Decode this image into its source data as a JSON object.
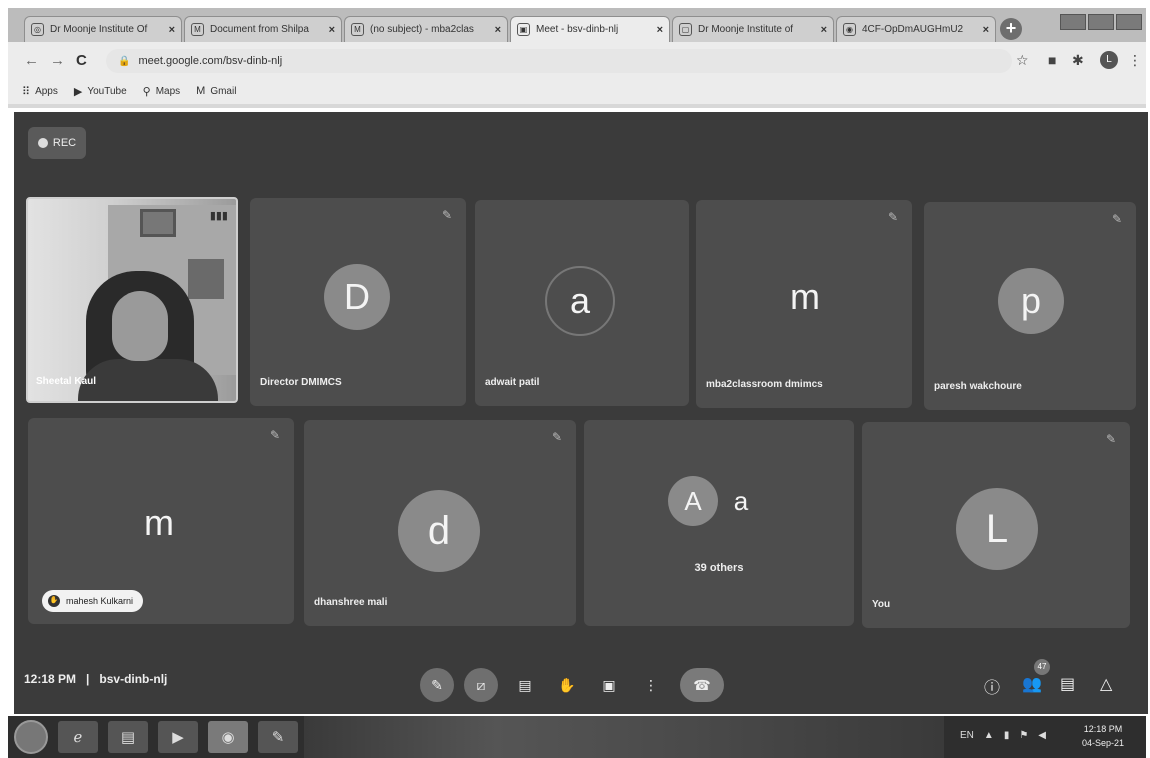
{
  "browser": {
    "tabs": [
      {
        "title": "Dr Moonje Institute Of",
        "icon": "globe-icon",
        "active": false
      },
      {
        "title": "Document from Shilpa",
        "icon": "gmail-icon",
        "active": false
      },
      {
        "title": "(no subject) - mba2clas",
        "icon": "gmail-icon",
        "active": false
      },
      {
        "title": "Meet - bsv-dinb-nlj",
        "icon": "meet-icon",
        "active": true
      },
      {
        "title": "Dr Moonje Institute of",
        "icon": "page-icon",
        "active": false
      },
      {
        "title": "4CF-OpDmAUGHmU2",
        "icon": "chrome-icon",
        "active": false
      }
    ],
    "url": "meet.google.com/bsv-dinb-nlj",
    "bookmarks": [
      {
        "label": "Apps",
        "icon": "apps-grid-icon"
      },
      {
        "label": "YouTube",
        "icon": "youtube-icon"
      },
      {
        "label": "Maps",
        "icon": "maps-pin-icon"
      },
      {
        "label": "Gmail",
        "icon": "gmail-icon"
      }
    ],
    "profile_initial": "L"
  },
  "meet": {
    "rec_label": "REC",
    "camera_tile": {
      "name": "Sheetal Kaul"
    },
    "tiles": [
      {
        "initial": "D",
        "name": "Director DMIMCS"
      },
      {
        "initial": "a",
        "name": "adwait patil"
      },
      {
        "initial": "m",
        "name": "mba2classroom dmimcs"
      },
      {
        "initial": "p",
        "name": "paresh wakchoure"
      },
      {
        "initial": "m",
        "name": "mahesh Kulkarni"
      },
      {
        "initial": "d",
        "name": "dhanshree mali"
      },
      {
        "initial": "L",
        "name": "You"
      }
    ],
    "others": {
      "initial_a": "A",
      "initial_b": "a",
      "label": "39 others"
    },
    "bottom": {
      "time": "12:18 PM",
      "separator": "|",
      "meeting_code": "bsv-dinb-nlj",
      "participant_count": "47"
    }
  },
  "taskbar": {
    "language": "EN",
    "time": "12:18 PM",
    "date": "04-Sep-21"
  }
}
